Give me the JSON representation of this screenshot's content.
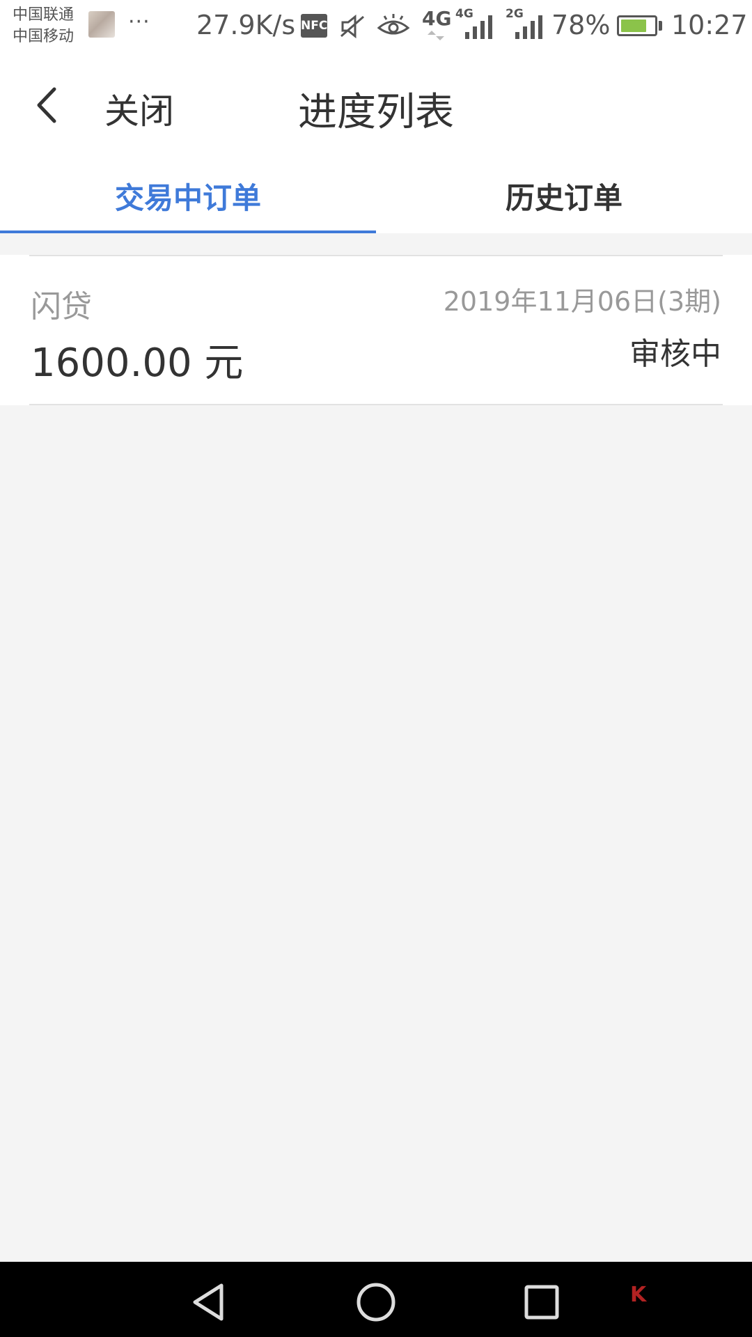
{
  "status_bar": {
    "carrier_1": "中国联通",
    "carrier_2": "中国移动",
    "more": "···",
    "net_speed": "27.9K/s",
    "nfc": "NFC",
    "network_1": "4G",
    "network_2": "4G",
    "network_3": "2G",
    "battery_percent": "78%",
    "battery_level": 0.78,
    "time": "10:27"
  },
  "header": {
    "close_label": "关闭",
    "title": "进度列表"
  },
  "tabs": [
    {
      "label": "交易中订单",
      "active": true
    },
    {
      "label": "历史订单",
      "active": false
    }
  ],
  "order": {
    "product": "闪贷",
    "date": "2019年11月06日(3期)",
    "amount": "1600.00 元",
    "status": "审核中"
  },
  "colors": {
    "accent": "#3f7ad9",
    "background": "#f4f4f4",
    "text_primary": "#333333",
    "text_secondary": "#999999"
  }
}
